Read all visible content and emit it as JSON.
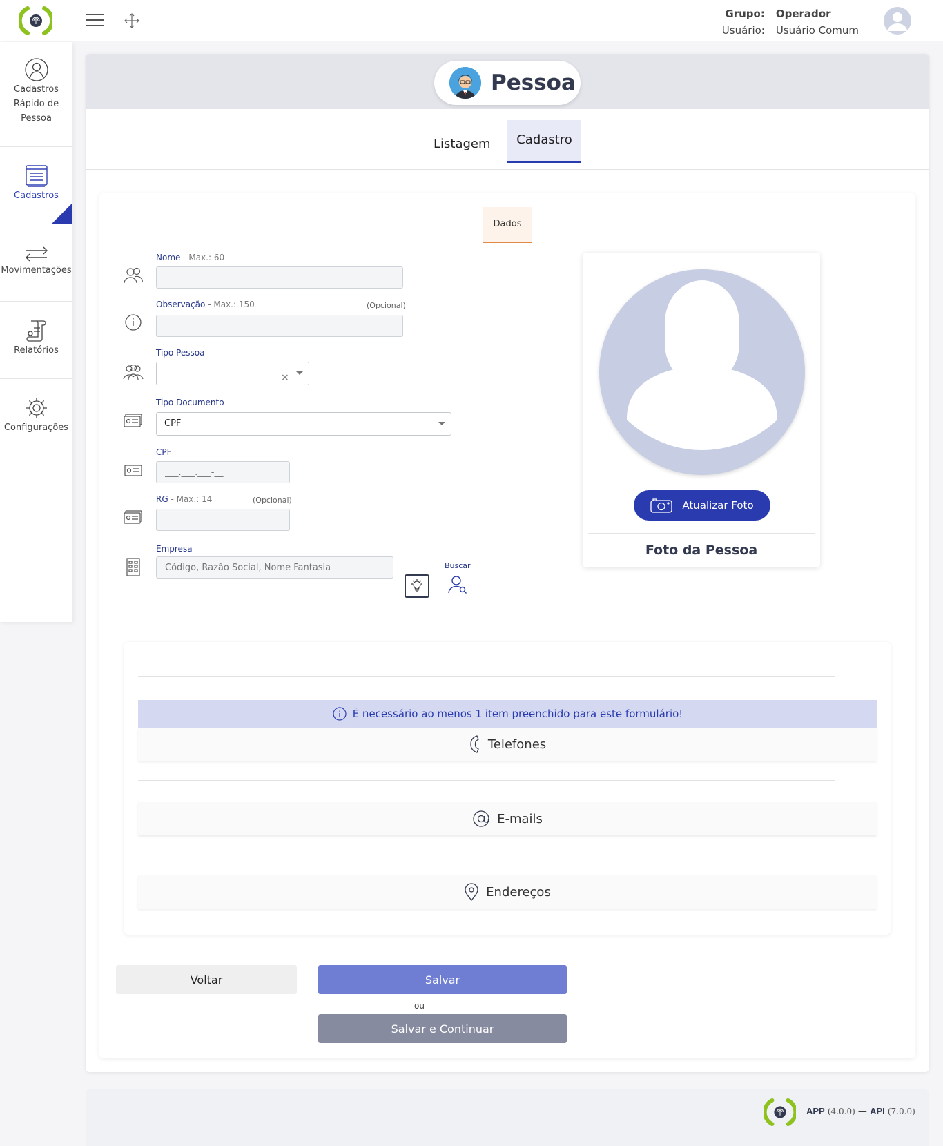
{
  "header": {
    "group_label": "Grupo:",
    "group_value": "Operador",
    "user_label": "Usuário:",
    "user_value": "Usuário Comum"
  },
  "sidebar": {
    "items": [
      {
        "line1": "Cadastros",
        "line2": "Rápido de",
        "line3": "Pessoa",
        "icon": "user-circle-icon"
      },
      {
        "label": "Cadastros",
        "icon": "form-list-icon",
        "active": true
      },
      {
        "label": "Movimentações",
        "icon": "transfer-arrows-icon"
      },
      {
        "label": "Relatórios",
        "icon": "report-scroll-icon"
      },
      {
        "label": "Configurações",
        "icon": "gear-icon"
      }
    ]
  },
  "page": {
    "title": "Pessoa",
    "tabs": [
      {
        "label": "Listagem"
      },
      {
        "label": "Cadastro",
        "active": true
      }
    ],
    "subtab": "Dados"
  },
  "form": {
    "nome": {
      "label": "Nome",
      "sub": " - Max.: 60",
      "value": ""
    },
    "observacao": {
      "label": "Observação",
      "sub": " - Max.: 150",
      "optional": "(Opcional)",
      "value": ""
    },
    "tipo_pessoa": {
      "label": "Tipo Pessoa",
      "value": "",
      "clear": "×"
    },
    "tipo_documento": {
      "label": "Tipo Documento",
      "value": "CPF"
    },
    "cpf": {
      "label": "CPF",
      "placeholder": "___.___.___-__"
    },
    "rg": {
      "label": "RG",
      "sub": " - Max.: 14",
      "optional": "(Opcional)",
      "value": ""
    },
    "empresa": {
      "label": "Empresa",
      "placeholder": "Código, Razão Social, Nome Fantasia",
      "search_label": "Buscar"
    }
  },
  "photo": {
    "button_label": "Atualizar Foto",
    "caption": "Foto da Pessoa"
  },
  "sections": {
    "info": "É necessário ao menos 1 item preenchido para este formulário!",
    "items": [
      {
        "label": "Telefones",
        "icon": "phone-icon"
      },
      {
        "label": "E-mails",
        "icon": "at-sign-icon"
      },
      {
        "label": "Endereços",
        "icon": "location-pin-icon"
      }
    ]
  },
  "actions": {
    "back": "Voltar",
    "save": "Salvar",
    "or": "ou",
    "save_continue": "Salvar e Continuar"
  },
  "footer": {
    "app_label": "APP",
    "app_version": "(4.0.0)",
    "dash": "—",
    "api_label": "API",
    "api_version": "(7.0.0)"
  },
  "colors": {
    "primary": "#2a3bb0",
    "save_button": "#6f7ed2",
    "continue_button": "#878ba0",
    "logo_green": "#8dc21f",
    "accent_orange": "#e08a45"
  }
}
